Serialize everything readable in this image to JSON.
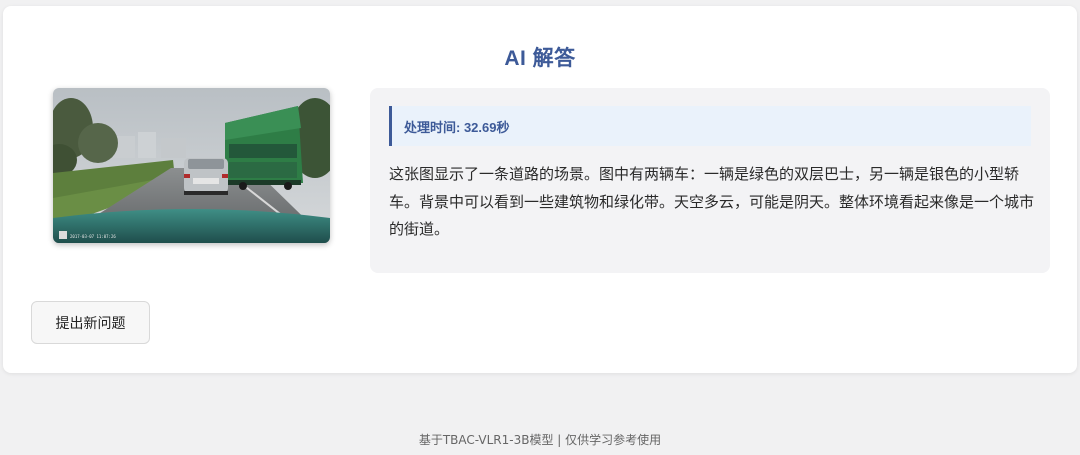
{
  "header": {
    "title": "AI 解答"
  },
  "image": {
    "timestamp": "2017-03-07 11:07:26"
  },
  "result": {
    "processing_time": "处理时间: 32.69秒",
    "answer": "这张图显示了一条道路的场景。图中有两辆车：一辆是绿色的双层巴士，另一辆是银色的小型轿车。背景中可以看到一些建筑物和绿化带。天空多云，可能是阴天。整体环境看起来像是一个城市的街道。"
  },
  "actions": {
    "new_question_label": "提出新问题"
  },
  "footer": {
    "text": "基于TBAC-VLR1-3B模型 | 仅供学习参考使用"
  },
  "colors": {
    "accent": "#3d5a98",
    "time_box_bg": "#eaf2fb",
    "panel_bg": "#f3f3f5",
    "page_bg": "#f1f1f2"
  }
}
